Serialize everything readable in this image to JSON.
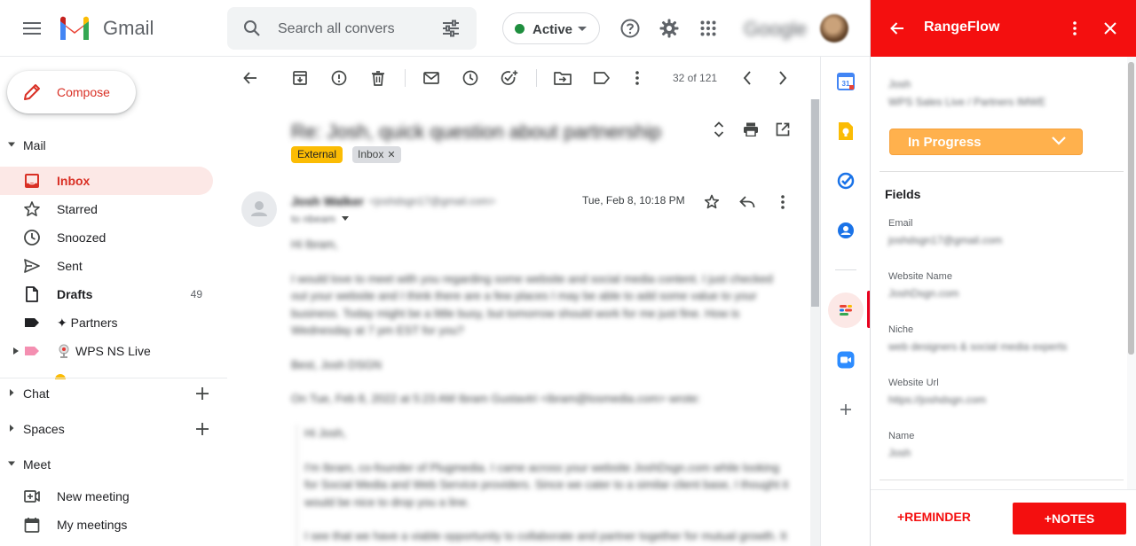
{
  "gmail": {
    "brand": "Gmail",
    "search_placeholder": "Search all convers",
    "status": "Active",
    "google_brand": "Google"
  },
  "nav": {
    "compose": "Compose",
    "mail_section": "Mail",
    "items": [
      {
        "label": "Inbox",
        "count": ""
      },
      {
        "label": "Starred",
        "count": ""
      },
      {
        "label": "Snoozed",
        "count": ""
      },
      {
        "label": "Sent",
        "count": ""
      },
      {
        "label": "Drafts",
        "count": "49"
      },
      {
        "label": "✦ Partners",
        "count": ""
      },
      {
        "label": "WPS NS Live",
        "count": ""
      }
    ],
    "chat_section": "Chat",
    "spaces_section": "Spaces",
    "meet_section": "Meet",
    "meet_items": [
      "New meeting",
      "My meetings"
    ]
  },
  "toolbar": {
    "pager": "32 of 121"
  },
  "email": {
    "subject": "Re: Josh, quick question about partnership",
    "labels": [
      "External",
      "Inbox"
    ],
    "sender_name": "Josh Walker",
    "sender_email": "<joshdsgn17@gmail.com>",
    "to_line": "to nbeam",
    "date": "Tue, Feb 8, 10:18 PM",
    "body": [
      "Hi Ibram,",
      "I would love to meet with you regarding some website and social media content. I just checked out your website and I think there are a few places I may be able to add some value to your business. Today might be a little busy, but tomorrow should work for me just fine. How is Wednesday at 7 pm EST for you?",
      "Best, Josh DSGN"
    ],
    "quote_header": "On Tue, Feb 8, 2022 at 5:23 AM Ibram Gustavtri <ibram@losmedia.com> wrote:",
    "quote": [
      "Hi Josh,",
      "I'm Ibram, co-founder of Plugmedia. I came across your website JoshDsgn.com while looking for Social Media and Web Service providers. Since we cater to a similar client base, I thought it would be nice to drop you a line.",
      "I see that we have a viable opportunity to collaborate and partner together for mutual growth. It"
    ]
  },
  "panel": {
    "title": "RangeFlow",
    "contact_name": "Josh",
    "contact_sub": "WPS Sales Live / Partners IMWE",
    "status": "In Progress",
    "fields_title": "Fields",
    "fields": [
      {
        "label": "Email",
        "value": "joshdsgn17@gmail.com"
      },
      {
        "label": "Website Name",
        "value": "JoshDsgn.com"
      },
      {
        "label": "Niche",
        "value": "web designers & social media experts"
      },
      {
        "label": "Website Url",
        "value": "https://joshdsgn.com"
      },
      {
        "label": "Name",
        "value": "Josh"
      }
    ],
    "reminder": "+REMINDER",
    "notes": "+NOTES"
  }
}
